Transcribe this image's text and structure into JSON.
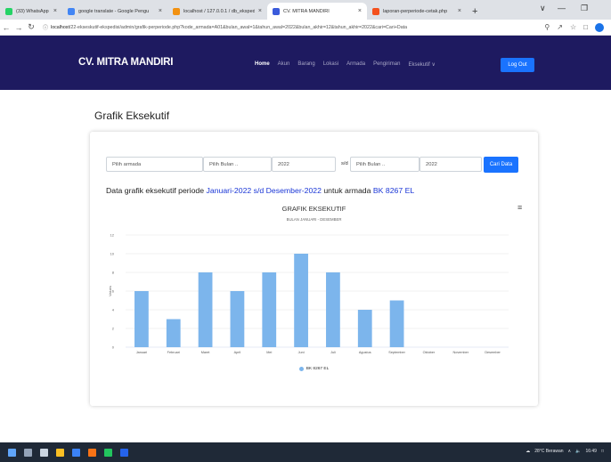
{
  "browser": {
    "tabs": [
      {
        "title": "(33) WhatsApp",
        "favicon_color": "#25d366",
        "active": false
      },
      {
        "title": "google translate - Google Pengu",
        "favicon_color": "#4285f4",
        "active": false
      },
      {
        "title": "localhost / 127.0.0.1 / db_ekspedis",
        "favicon_color": "#f29111",
        "active": false
      },
      {
        "title": "CV. MITRA MANDIRI",
        "favicon_color": "#3b5bdb",
        "active": true
      },
      {
        "title": "laporan-perperiode-cetak.php",
        "favicon_color": "#f4511e",
        "active": false
      }
    ],
    "new_tab": "+",
    "url_host": "localhost",
    "url_path": "/22-ekseskutif-ekspedisi/admin/grafik-perperiode.php?kode_armada=A01&bulan_awal=1&tahun_awal=2022&bulan_akhir=12&tahun_akhir=2022&cari=Cari+Data"
  },
  "navbar": {
    "brand": "CV. MITRA MANDIRI",
    "links": [
      "Home",
      "Akun",
      "Barang",
      "Lokasi",
      "Armada",
      "Pengiriman",
      "Eksekutif ∨"
    ],
    "active_link": "Home",
    "logout_label": "Log Out",
    "bg_color": "#1e1a60",
    "accent_color": "#1a73ff"
  },
  "page": {
    "title": "Grafik Eksekutif"
  },
  "filter": {
    "armada_placeholder": "Pilih armada",
    "bulan_awal_placeholder": "Pilih Bulan ..",
    "tahun_awal": "2022",
    "separator": "s/d",
    "bulan_akhir_placeholder": "Pilih Bulan ..",
    "tahun_akhir": "2022",
    "submit_label": "Cari Data"
  },
  "period_text": {
    "prefix": "Data grafik eksekutif periode ",
    "period": "Januari-2022 s/d Desember-2022",
    "middle": " untuk armada ",
    "armada": "BK 8267 EL"
  },
  "chart_data": {
    "type": "bar",
    "title": "GRAFIK EKSEKUTIF",
    "subtitle": "BULAN JANUARI - DESEMBER",
    "ylabel": "Values",
    "ylim": [
      0,
      12
    ],
    "yticks": [
      0,
      2,
      4,
      6,
      8,
      10,
      12
    ],
    "categories": [
      "Januari",
      "Februari",
      "Maret",
      "April",
      "Mei",
      "Juni",
      "Juli",
      "Agustus",
      "September",
      "Oktober",
      "November",
      "Desember"
    ],
    "series": [
      {
        "name": "BK 8267 EL",
        "color": "#7cb5ec",
        "values": [
          6,
          3,
          8,
          6,
          8,
          10,
          8,
          4,
          5,
          0,
          0,
          0
        ]
      }
    ],
    "grid": true,
    "legend": "bottom-center"
  },
  "taskbar": {
    "weather": "28°C Berawan",
    "time": "16:49"
  }
}
